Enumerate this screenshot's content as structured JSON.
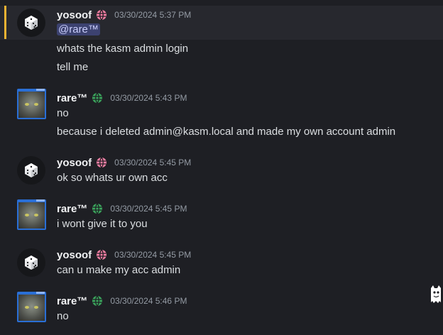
{
  "colors": {
    "background": "#1e1f24",
    "highlight": "#27282e",
    "highlight_bar": "#f0b232",
    "yosoof_badge": "#f47fa4",
    "rare_badge": "#3ba55c",
    "mention_bg": "#3c4270"
  },
  "messages": [
    {
      "author": "yosoof",
      "avatar": "dice-avatar",
      "badge": "globe-icon",
      "timestamp": "03/30/2024 5:37 PM",
      "mention": "@rare™",
      "lines": [
        "whats the kasm admin login",
        "tell me"
      ]
    },
    {
      "author": "rare™",
      "avatar": "cat-avatar",
      "badge": "globe-icon",
      "timestamp": "03/30/2024 5:43 PM",
      "lines": [
        "no",
        "because i deleted admin@kasm.local and made my own account admin"
      ]
    },
    {
      "author": "yosoof",
      "avatar": "dice-avatar",
      "badge": "globe-icon",
      "timestamp": "03/30/2024 5:45 PM",
      "lines": [
        "ok so whats ur own acc"
      ]
    },
    {
      "author": "rare™",
      "avatar": "cat-avatar",
      "badge": "globe-icon",
      "timestamp": "03/30/2024 5:45 PM",
      "lines": [
        "i wont give it to you"
      ]
    },
    {
      "author": "yosoof",
      "avatar": "dice-avatar",
      "badge": "globe-icon",
      "timestamp": "03/30/2024 5:45 PM",
      "lines": [
        "can u make my acc admin"
      ]
    },
    {
      "author": "rare™",
      "avatar": "cat-avatar",
      "badge": "globe-icon",
      "timestamp": "03/30/2024 5:46 PM",
      "lines": [
        "no"
      ]
    }
  ]
}
